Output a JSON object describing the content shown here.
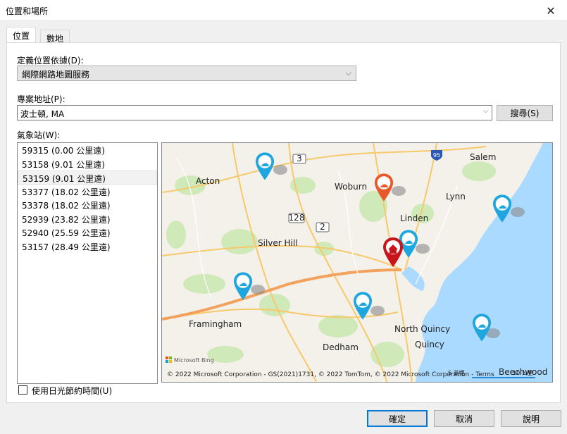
{
  "window": {
    "title": "位置和場所",
    "close_glyph": "✕"
  },
  "tabs": [
    {
      "label": "位置",
      "active": true
    },
    {
      "label": "數地",
      "active": false
    }
  ],
  "define_location": {
    "label": "定義位置依據(D):",
    "value": "網際網路地圖服務"
  },
  "project_address": {
    "label": "專案地址(P):",
    "value": "波士頓, MA",
    "search_button": "搜尋(S)"
  },
  "weather_stations": {
    "label": "氣象站(W):",
    "items": [
      "59315 (0.00 公里遠)",
      "53158 (9.01 公里遠)",
      "53159 (9.01 公里遠)",
      "53377 (18.02 公里遠)",
      "53378 (18.02 公里遠)",
      "52939 (23.82 公里遠)",
      "52940 (25.59 公里遠)",
      "53157 (28.49 公里遠)"
    ],
    "selected_index": 2
  },
  "map": {
    "cities": [
      "Acton",
      "Woburn",
      "Salem",
      "Lynn",
      "Linden",
      "Silver Hill",
      "Framingham",
      "North Quincy",
      "Quincy",
      "Dedham",
      "Beechwood"
    ],
    "road_labels": [
      "3",
      "95",
      "128",
      "2"
    ],
    "brand": "Microsoft Bing",
    "copyright": "© 2022 Microsoft Corporation - GS(2021)1731, © 2022 TomTom, © 2022 Microsoft Corporation - Terms",
    "scale": "5 英哩",
    "scale_km": "10 公里"
  },
  "daylight_saving": {
    "label": "使用日光節約時間(U)",
    "checked": false
  },
  "footer": {
    "ok": "確定",
    "cancel": "取消",
    "help": "說明"
  },
  "colors": {
    "accent": "#0078d7",
    "pin_blue": "#1fa6df",
    "pin_orange": "#e8582a",
    "pin_red": "#c8151b"
  }
}
